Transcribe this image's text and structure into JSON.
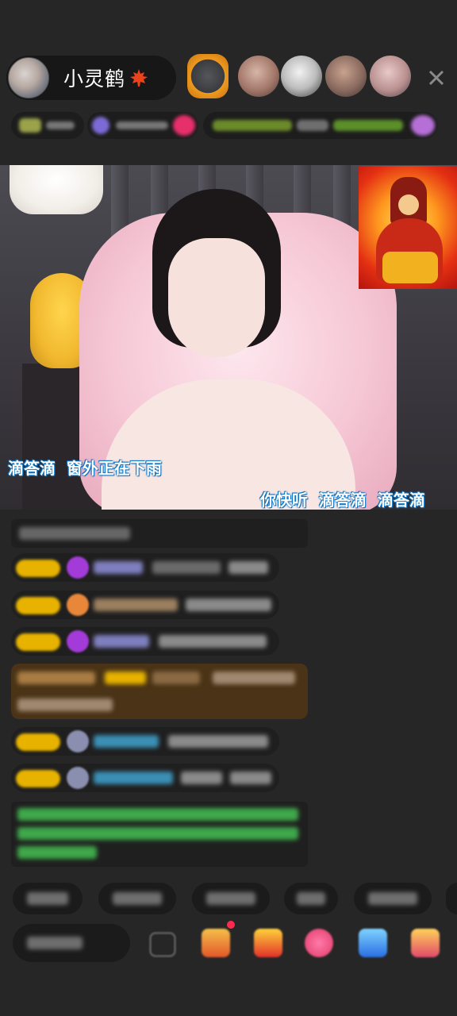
{
  "host": {
    "name": "小灵鹤",
    "name_emoji": "maple-leaf"
  },
  "header": {
    "close_icon": "close-x",
    "viewer_count_visible": 5
  },
  "video": {
    "caption_left": "滴答滴  窗外正在下雨",
    "caption_right": "你快听  滴答滴  滴答滴",
    "sticker_icon": "god-of-wealth-sticker"
  },
  "colors": {
    "background": "#262626",
    "caption_outline": "#0a74c4",
    "level_badge": "#e7b300",
    "notice_bg": "#4a3316",
    "system_text": "#3fa84a"
  },
  "chat": {
    "message_count": 8
  },
  "bottom": {
    "quick_reply_count": 6,
    "tool_icons": [
      "screen-icon",
      "gift-box-icon",
      "fries-icon",
      "heart-gift-icon",
      "game-icon",
      "shop-icon"
    ]
  }
}
